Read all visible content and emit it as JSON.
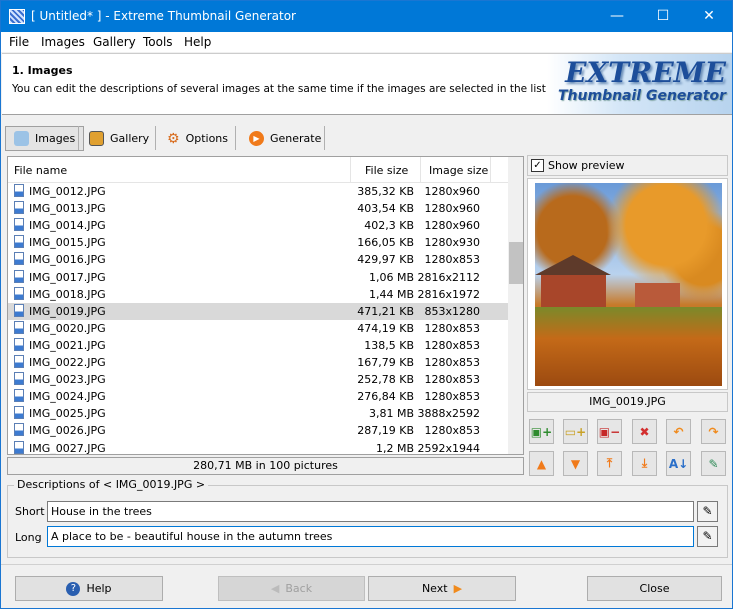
{
  "window": {
    "title": "[ Untitled* ] - Extreme Thumbnail Generator",
    "minimize": "—",
    "maximize": "☐",
    "close": "✕"
  },
  "menu": [
    "File",
    "Images",
    "Gallery",
    "Tools",
    "Help"
  ],
  "header": {
    "title": "1. Images",
    "description": "You can edit the descriptions of several images at the same time if the images are selected in the list.",
    "logo_line1": "EXTREME",
    "logo_line2": "Thumbnail Generator"
  },
  "tabs": [
    {
      "label": "Images",
      "active": true
    },
    {
      "label": "Gallery"
    },
    {
      "label": "Options"
    },
    {
      "label": "Generate"
    }
  ],
  "list": {
    "columns": [
      "File name",
      "File size",
      "Image size"
    ],
    "rows": [
      [
        "IMG_0012.JPG",
        "385,32 KB",
        "1280x960"
      ],
      [
        "IMG_0013.JPG",
        "403,54 KB",
        "1280x960"
      ],
      [
        "IMG_0014.JPG",
        "402,3 KB",
        "1280x960"
      ],
      [
        "IMG_0015.JPG",
        "166,05 KB",
        "1280x930"
      ],
      [
        "IMG_0016.JPG",
        "429,97 KB",
        "1280x853"
      ],
      [
        "IMG_0017.JPG",
        "1,06 MB",
        "2816x2112"
      ],
      [
        "IMG_0018.JPG",
        "1,44 MB",
        "2816x1972"
      ],
      [
        "IMG_0019.JPG",
        "471,21 KB",
        "853x1280"
      ],
      [
        "IMG_0020.JPG",
        "474,19 KB",
        "1280x853"
      ],
      [
        "IMG_0021.JPG",
        "138,5 KB",
        "1280x853"
      ],
      [
        "IMG_0022.JPG",
        "167,79 KB",
        "1280x853"
      ],
      [
        "IMG_0023.JPG",
        "252,78 KB",
        "1280x853"
      ],
      [
        "IMG_0024.JPG",
        "276,84 KB",
        "1280x853"
      ],
      [
        "IMG_0025.JPG",
        "3,81 MB",
        "3888x2592"
      ],
      [
        "IMG_0026.JPG",
        "287,19 KB",
        "1280x853"
      ],
      [
        "IMG_0027.JPG",
        "1,2 MB",
        "2592x1944"
      ]
    ],
    "selected_index": 7,
    "summary": "280,71 MB in 100 pictures"
  },
  "preview": {
    "show_preview_label": "Show preview",
    "show_preview_checked": true,
    "filename": "IMG_0019.JPG",
    "toolbar_icons": [
      "add-image-icon",
      "add-folder-icon",
      "remove-image-icon",
      "remove-all-icon",
      "undo-icon",
      "redo-icon",
      "move-up-icon",
      "move-down-icon",
      "move-top-icon",
      "move-bottom-icon",
      "sort-az-icon",
      "edit-image-icon"
    ]
  },
  "descriptions": {
    "legend": "Descriptions of < IMG_0019.JPG >",
    "short_label": "Short",
    "short_value": "House in the trees",
    "long_label": "Long",
    "long_value": "A place to be - beautiful house in the autumn trees"
  },
  "buttons": {
    "help": "Help",
    "back": "Back",
    "next": "Next",
    "close": "Close"
  },
  "colors": {
    "titlebar": "#0078d7",
    "accent_orange": "#f08a1c"
  }
}
